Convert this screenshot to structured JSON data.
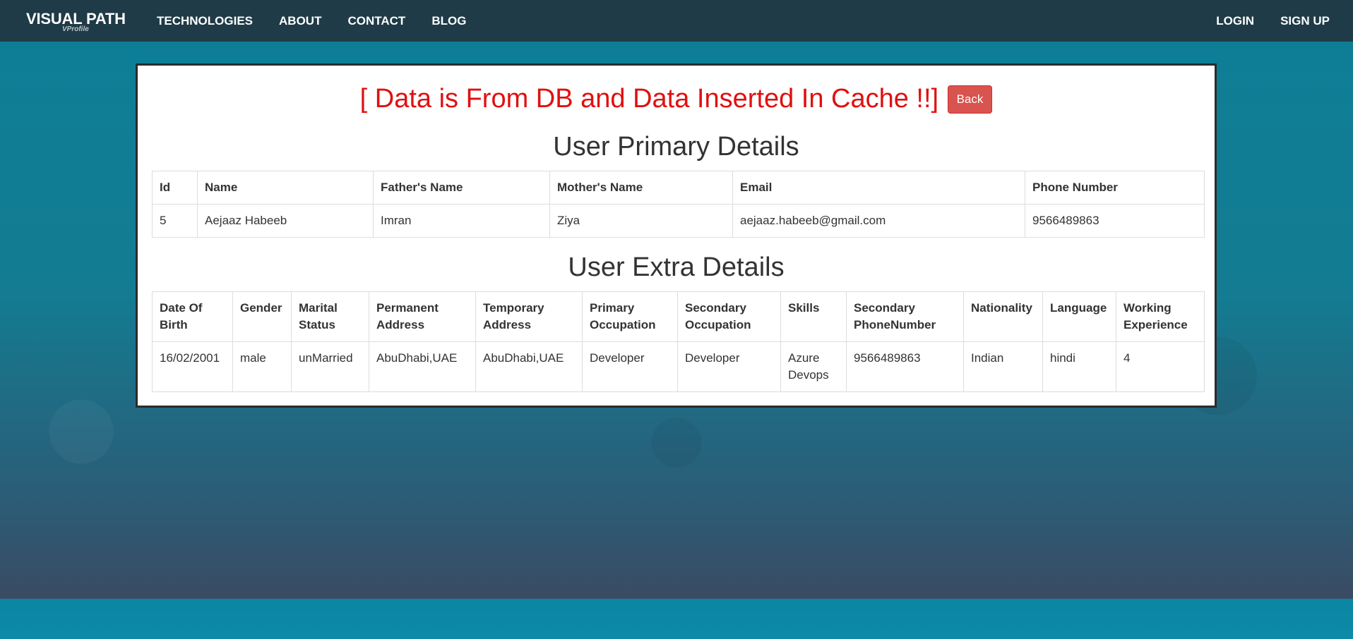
{
  "nav": {
    "brand": "VISUAL PATH",
    "brand_sub": "VProfile",
    "links": [
      "TECHNOLOGIES",
      "ABOUT",
      "CONTACT",
      "BLOG"
    ],
    "login": "LOGIN",
    "signup": "SIGN UP"
  },
  "message": "[ Data is From DB and Data Inserted In Cache !!]",
  "back_label": "Back",
  "primary": {
    "title": "User Primary Details",
    "headers": [
      "Id",
      "Name",
      "Father's Name",
      "Mother's Name",
      "Email",
      "Phone Number"
    ],
    "row": [
      "5",
      "Aejaaz Habeeb",
      "Imran",
      "Ziya",
      "aejaaz.habeeb@gmail.com",
      "9566489863"
    ]
  },
  "extra": {
    "title": "User Extra Details",
    "headers": [
      "Date Of Birth",
      "Gender",
      "Marital Status",
      "Permanent Address",
      "Temporary Address",
      "Primary Occupation",
      "Secondary Occupation",
      "Skills",
      "Secondary PhoneNumber",
      "Nationality",
      "Language",
      "Working Experience"
    ],
    "row": [
      "16/02/2001",
      "male",
      "unMarried",
      "AbuDhabi,UAE",
      "AbuDhabi,UAE",
      "Developer",
      "Developer",
      "Azure Devops",
      "9566489863",
      "Indian",
      "hindi",
      "4"
    ]
  },
  "colors": {
    "navbar": "#1f3b47",
    "message": "#e01010",
    "back_button": "#d9534f"
  }
}
